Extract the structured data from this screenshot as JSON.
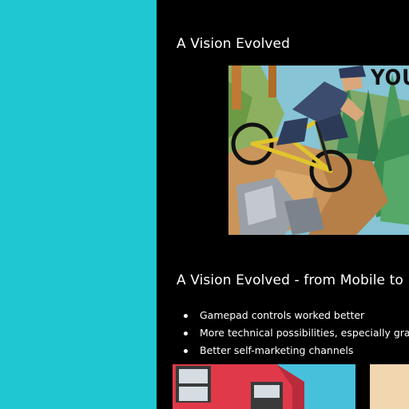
{
  "slides": {
    "title_1": "A Vision Evolved",
    "image_text": "YOU",
    "title_2": "A Vision Evolved - from Mobile to",
    "bullets": [
      "Gamepad controls worked better",
      "More technical possibilities, especially graphics",
      "Better self-marketing channels"
    ]
  },
  "colors": {
    "left_panel": "#1ec8d2",
    "document_background": "#000000",
    "text": "#ffffff"
  },
  "icons": [
    "mountain-bike-scene",
    "building-thumbnail"
  ]
}
